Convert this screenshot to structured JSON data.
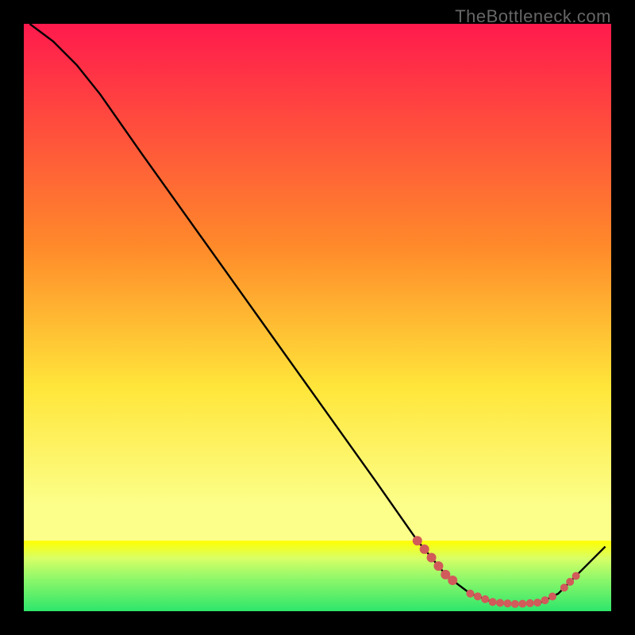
{
  "watermark": "TheBottleneck.com",
  "chart_data": {
    "type": "line",
    "xlim": [
      0,
      100
    ],
    "ylim": [
      0,
      100
    ],
    "title": "",
    "xlabel": "",
    "ylabel": "",
    "gradient_top": "#ff1a4d",
    "gradient_mid1": "#ff8a2a",
    "gradient_mid2": "#ffe63a",
    "gradient_mid3": "#fcff8a",
    "gradient_bottom": "#2ee66b",
    "green_band_top": 12,
    "green_band_top_color": "#ffff00",
    "line_color": "#000000",
    "marker_color": "#d15a5a",
    "curve": [
      {
        "x": 1,
        "y": 100
      },
      {
        "x": 5,
        "y": 97
      },
      {
        "x": 9,
        "y": 93
      },
      {
        "x": 13,
        "y": 88
      },
      {
        "x": 20,
        "y": 78
      },
      {
        "x": 30,
        "y": 64
      },
      {
        "x": 40,
        "y": 50
      },
      {
        "x": 50,
        "y": 36
      },
      {
        "x": 60,
        "y": 22
      },
      {
        "x": 67,
        "y": 12
      },
      {
        "x": 72,
        "y": 6
      },
      {
        "x": 76,
        "y": 3
      },
      {
        "x": 80,
        "y": 1.5
      },
      {
        "x": 84,
        "y": 1.2
      },
      {
        "x": 88,
        "y": 1.5
      },
      {
        "x": 91,
        "y": 3
      },
      {
        "x": 95,
        "y": 7
      },
      {
        "x": 99,
        "y": 11
      }
    ],
    "markers_range1": {
      "x_from": 67,
      "x_to": 73,
      "count": 6
    },
    "markers_range2": {
      "x_from": 76,
      "x_to": 90,
      "count": 12
    },
    "markers_range3": {
      "x_from": 92,
      "x_to": 94,
      "count": 3
    }
  }
}
